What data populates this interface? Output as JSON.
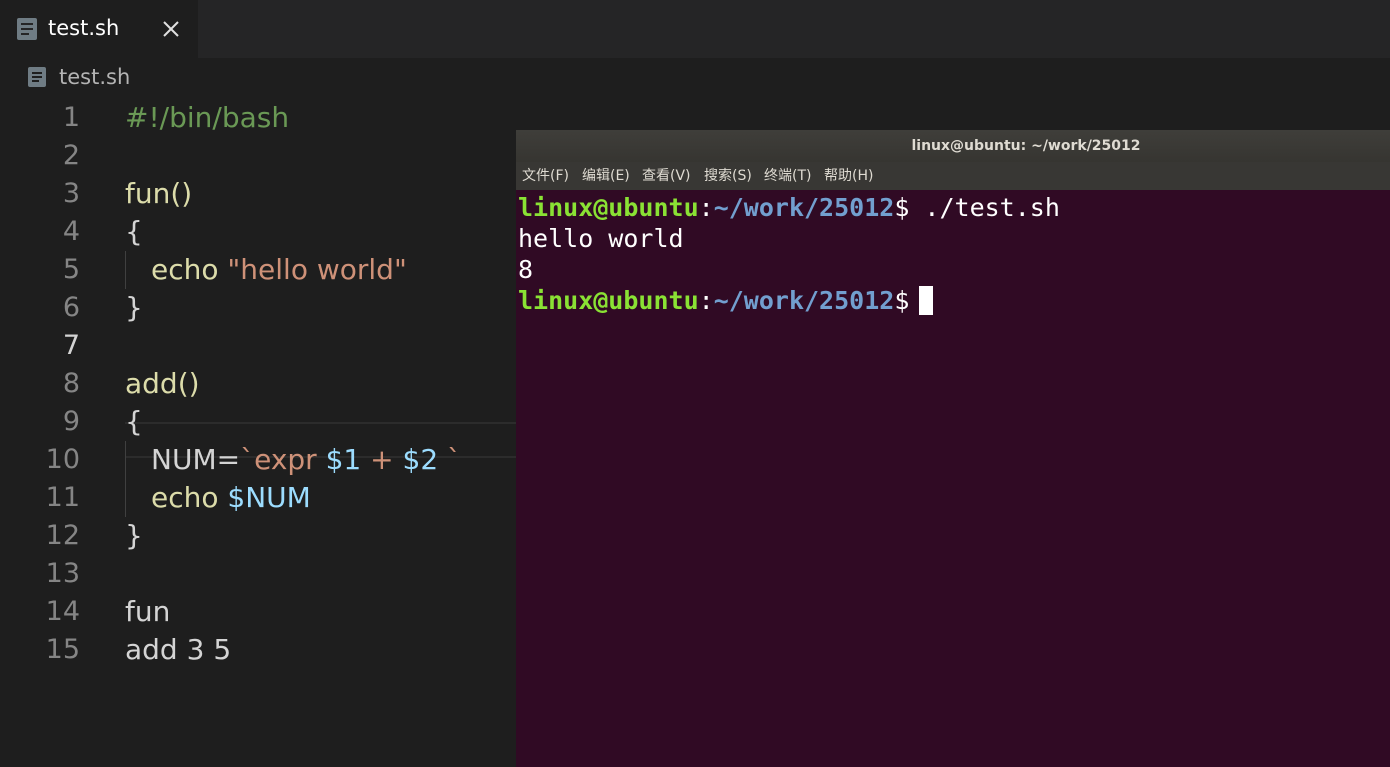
{
  "editor": {
    "tab": {
      "label": "test.sh"
    },
    "breadcrumb": {
      "label": "test.sh"
    },
    "line_numbers": [
      "1",
      "2",
      "3",
      "4",
      "5",
      "6",
      "7",
      "8",
      "9",
      "10",
      "11",
      "12",
      "13",
      "14",
      "15"
    ],
    "active_line": "7",
    "code": {
      "l1": {
        "text": "#!/bin/bash"
      },
      "l3": {
        "text": "fun()"
      },
      "l4": {
        "text": "{"
      },
      "l5": {
        "kw": "echo",
        "str": "\"hello world\""
      },
      "l6": {
        "text": "}"
      },
      "l8": {
        "text": "add()"
      },
      "l9": {
        "text": "{"
      },
      "l10": {
        "var": "NUM",
        "eq": "=",
        "tick1": "`",
        "cmd": "expr",
        "arg1": "$1",
        "op": "+",
        "arg2": "$2",
        "tick2": "`"
      },
      "l11": {
        "kw": "echo",
        "var": "$NUM"
      },
      "l12": {
        "text": "}"
      },
      "l14": {
        "text": "fun"
      },
      "l15": {
        "text": "add 3 5"
      }
    }
  },
  "terminal": {
    "title": "linux@ubuntu: ~/work/25012",
    "menu": [
      "文件(F)",
      "编辑(E)",
      "查看(V)",
      "搜索(S)",
      "终端(T)",
      "帮助(H)"
    ],
    "prompt_user": "linux@ubuntu",
    "prompt_sep": ":",
    "prompt_path": "~/work/25012",
    "prompt_symbol": "$",
    "command": " ./test.sh",
    "output": [
      "hello world",
      "8"
    ]
  },
  "colors": {
    "editor_bg": "#1e1e1e",
    "terminal_bg": "#300a24",
    "prompt_user": "#8ae234",
    "prompt_path": "#729fcf",
    "comment": "#6a9955",
    "string": "#ce9178",
    "variable": "#9cdcfe",
    "function": "#dcdcaa"
  },
  "icons": {
    "tab": "file-lines-icon",
    "close": "close-icon",
    "breadcrumb": "file-lines-icon"
  }
}
